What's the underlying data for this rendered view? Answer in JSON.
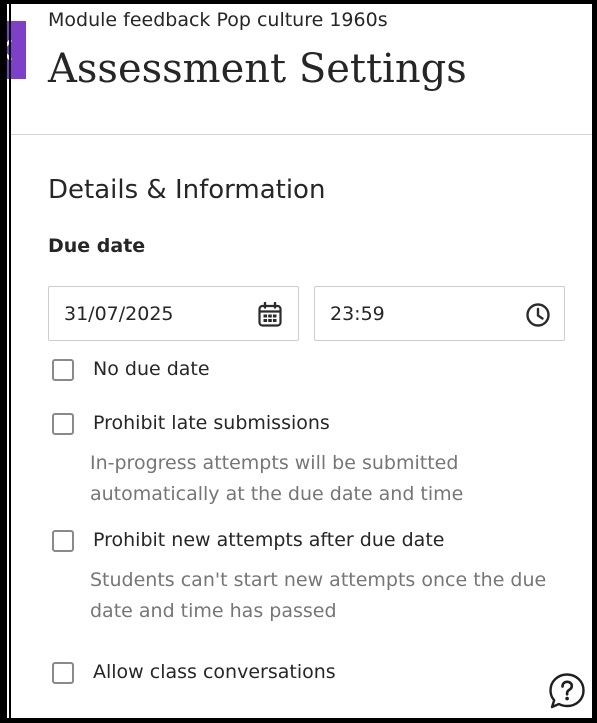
{
  "header": {
    "course_title": "Module feedback Pop culture 1960s",
    "page_title": "Assessment Settings",
    "back_icon": "chevron-left-icon"
  },
  "details": {
    "section_title": "Details & Information",
    "due_date_label": "Due date",
    "date_value": "31/07/2025",
    "date_icon": "calendar-icon",
    "time_value": "23:59",
    "time_icon": "clock-icon"
  },
  "options": [
    {
      "label": "No due date",
      "checked": false,
      "description": ""
    },
    {
      "label": "Prohibit late submissions",
      "checked": false,
      "description": "In-progress attempts will be submitted automatically at the due date and time"
    },
    {
      "label": "Prohibit new attempts after due date",
      "checked": false,
      "description": "Students can't start new attempts once the due date and time has passed"
    },
    {
      "label": "Allow class conversations",
      "checked": false,
      "description": ""
    }
  ],
  "help": {
    "icon": "help-icon"
  },
  "colors": {
    "accent": "#7e3fc9",
    "text": "#262626",
    "muted": "#767676",
    "border": "#cdcdcd"
  }
}
